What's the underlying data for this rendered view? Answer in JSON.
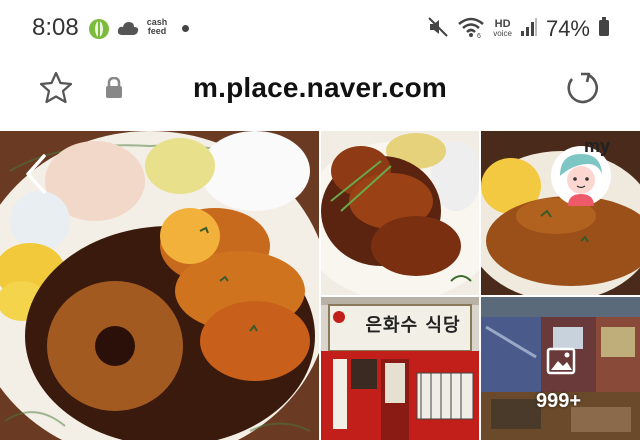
{
  "status": {
    "time": "8:08",
    "cash_feed": "cash feed",
    "hd_label": "HD",
    "hd_sub": "voice",
    "battery": "74%"
  },
  "browser": {
    "url": "m.place.naver.com",
    "icons": [
      "star-icon",
      "lock-icon",
      "refresh-icon"
    ]
  },
  "gallery": {
    "sign_text": "은화수 식당",
    "photo_count": "999+",
    "avatar_label": "my",
    "icons": [
      "chevron-left-icon",
      "image-gallery-icon"
    ]
  }
}
